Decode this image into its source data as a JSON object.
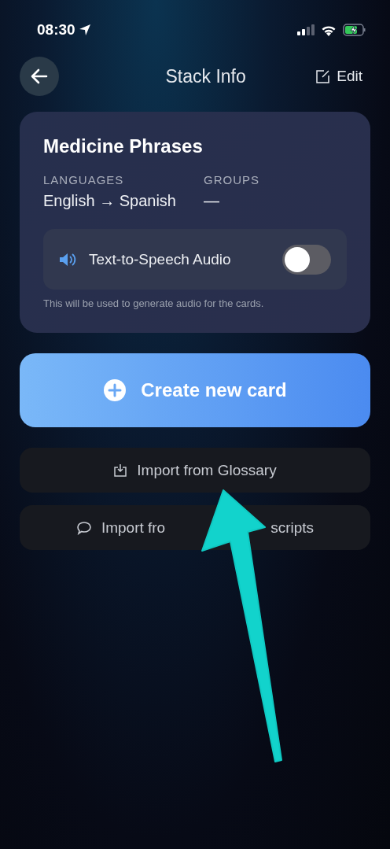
{
  "status_bar": {
    "time": "08:30"
  },
  "nav": {
    "title": "Stack Info",
    "edit_label": "Edit"
  },
  "stack": {
    "name": "Medicine Phrases",
    "fields": [
      {
        "label": "LANGUAGES",
        "value": "English → Spanish"
      },
      {
        "label": "GROUPS",
        "value": "—"
      }
    ],
    "tts": {
      "label": "Text-to-Speech Audio",
      "on": false,
      "hint": "This will be used to generate audio for the cards."
    }
  },
  "create_button": {
    "label": "Create new card"
  },
  "import_buttons": [
    {
      "kind": "glossary",
      "label_start": "Import from Glossary"
    },
    {
      "kind": "chat",
      "label_start": "Import fro",
      "label_end": "scripts"
    }
  ],
  "annotation": {
    "kind": "arrow"
  }
}
